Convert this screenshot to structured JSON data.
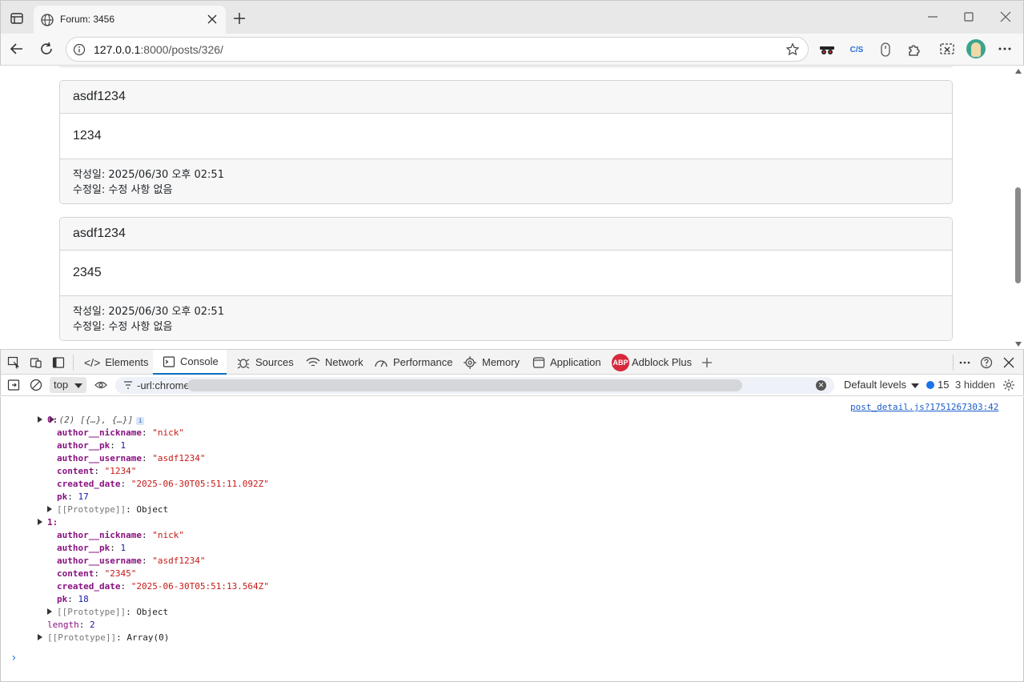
{
  "browser": {
    "tab_title": "Forum: 3456",
    "url_host": "127.0.0.1",
    "url_rest": ":8000/posts/326/"
  },
  "page": {
    "comments": [
      {
        "author": "asdf1234",
        "content": "1234",
        "created": "작성일: 2025/06/30 오후 02:51",
        "modified": "수정일: 수정 사항 없음"
      },
      {
        "author": "asdf1234",
        "content": "2345",
        "created": "작성일: 2025/06/30 오후 02:51",
        "modified": "수정일: 수정 사항 없음"
      }
    ]
  },
  "devtools": {
    "tabs": [
      "Elements",
      "Console",
      "Sources",
      "Network",
      "Performance",
      "Memory",
      "Application",
      "Adblock Plus"
    ],
    "active_tab": "Console",
    "context": "top",
    "filter_text": "-url:chrome",
    "levels_label": "Default levels",
    "issues_count": "15",
    "hidden_label": "3 hidden",
    "abp_badge": "ABP",
    "ext_css_label": "C/S"
  },
  "console": {
    "summary": "(2) [{…}, {…}]",
    "info_badge": "i",
    "source_link": "post_detail.js?1751267303:42",
    "items": [
      {
        "index_label": "0:",
        "fields": [
          {
            "key": "author__nickname",
            "value": "\"nick\"",
            "kind": "str"
          },
          {
            "key": "author__pk",
            "value": "1",
            "kind": "num"
          },
          {
            "key": "author__username",
            "value": "\"asdf1234\"",
            "kind": "str"
          },
          {
            "key": "content",
            "value": "\"1234\"",
            "kind": "str"
          },
          {
            "key": "created_date",
            "value": "\"2025-06-30T05:51:11.092Z\"",
            "kind": "str"
          },
          {
            "key": "pk",
            "value": "17",
            "kind": "num"
          }
        ],
        "prototype": "[[Prototype]]",
        "prototype_value": "Object"
      },
      {
        "index_label": "1:",
        "fields": [
          {
            "key": "author__nickname",
            "value": "\"nick\"",
            "kind": "str"
          },
          {
            "key": "author__pk",
            "value": "1",
            "kind": "num"
          },
          {
            "key": "author__username",
            "value": "\"asdf1234\"",
            "kind": "str"
          },
          {
            "key": "content",
            "value": "\"2345\"",
            "kind": "str"
          },
          {
            "key": "created_date",
            "value": "\"2025-06-30T05:51:13.564Z\"",
            "kind": "str"
          },
          {
            "key": "pk",
            "value": "18",
            "kind": "num"
          }
        ],
        "prototype": "[[Prototype]]",
        "prototype_value": "Object"
      }
    ],
    "length_key": "length",
    "length_value": "2",
    "array_prototype": "[[Prototype]]",
    "array_prototype_value": "Array(0)",
    "prompt": "›"
  }
}
